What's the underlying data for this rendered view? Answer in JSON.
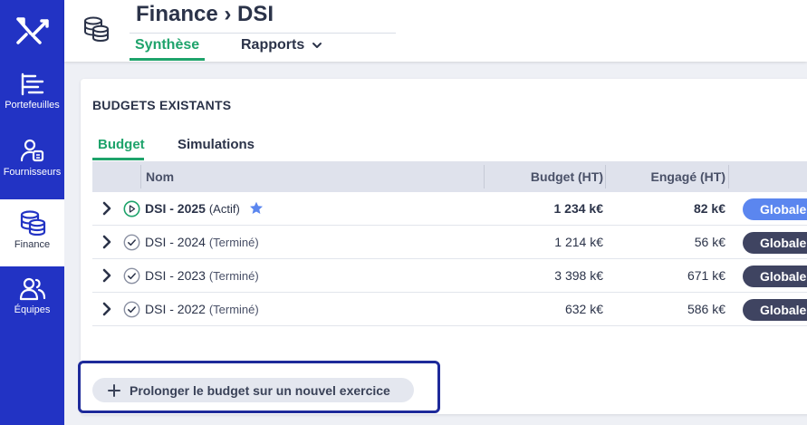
{
  "sidebar": {
    "items": [
      {
        "label": "Portefeuilles",
        "icon": "portfolio-icon"
      },
      {
        "label": "Fournisseurs",
        "icon": "supplier-icon"
      },
      {
        "label": "Finance",
        "icon": "coins-icon"
      },
      {
        "label": "Équipes",
        "icon": "team-icon"
      }
    ],
    "active_index": 2,
    "color": "#2233c4"
  },
  "header": {
    "title": "Finance › DSI",
    "icon": "coins-icon",
    "tabs": [
      {
        "label": "Synthèse",
        "active": true
      },
      {
        "label": "Rapports",
        "dropdown": true
      }
    ]
  },
  "section": {
    "title": "BUDGETS EXISTANTS",
    "tabs": [
      {
        "label": "Budget",
        "active": true
      },
      {
        "label": "Simulations",
        "active": false
      }
    ]
  },
  "table": {
    "columns": {
      "name": "Nom",
      "budget": "Budget (HT)",
      "engage": "Engagé (HT)"
    },
    "rows": [
      {
        "name": "DSI - 2025",
        "status": "(Actif)",
        "budget": "1 234 k€",
        "engage": "82 k€",
        "badge": "Globale",
        "active": true,
        "starred": true
      },
      {
        "name": "DSI - 2024",
        "status": "(Terminé)",
        "budget": "1 214 k€",
        "engage": "56 k€",
        "badge": "Globale",
        "active": false
      },
      {
        "name": "DSI - 2023",
        "status": "(Terminé)",
        "budget": "3 398 k€",
        "engage": "671 k€",
        "badge": "Globale",
        "active": false
      },
      {
        "name": "DSI - 2022",
        "status": "(Terminé)",
        "budget": "632 k€",
        "engage": "586 k€",
        "badge": "Globale",
        "active": false
      }
    ]
  },
  "actions": {
    "extend_label": "Prolonger le budget sur un nouvel exercice"
  },
  "colors": {
    "accent_green": "#1ea36b",
    "active_badge": "#5b86ef",
    "badge": "#3f4461"
  }
}
